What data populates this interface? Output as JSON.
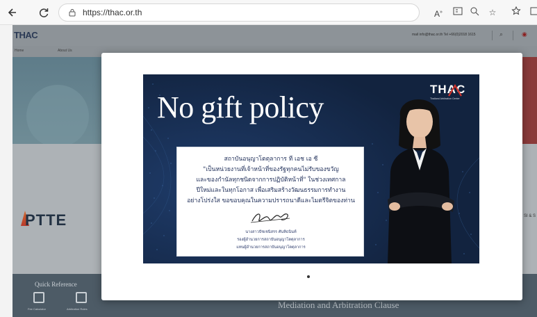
{
  "browser": {
    "back_icon": "arrow-left-icon",
    "refresh_icon": "refresh-icon",
    "url": "https://thac.or.th",
    "tools": [
      "read-aloud-icon",
      "immersive-reader-icon",
      "zoom-icon",
      "favorite-add-icon",
      "favorites-icon",
      "collections-icon"
    ]
  },
  "site": {
    "logo": "THAC",
    "contact": "mail info@thac.or.th   Tel +66(0)2018 1615",
    "nav": [
      "Home",
      "About Us"
    ],
    "partner_logo": "PTTE",
    "right_fragment": "SI & S",
    "quick_reference": {
      "title": "Quick Reference",
      "items": [
        "Fee Calculator",
        "Arbitration Rules"
      ]
    },
    "mediation_title": "Mediation and Arbitration Clause"
  },
  "modal": {
    "poster": {
      "title": "No gift policy",
      "brand": "THAC",
      "brand_sub": "Thailand Arbitration Center",
      "message": [
        "สถาบันอนุญาโตตุลาการ ที เอช เอ ซี",
        "\"เป็นหน่วยงานที่เจ้าหน้าที่ของรัฐทุกคนไม่รับของขวัญ",
        "และของกำนัลทุกชนิดจากการปฏิบัติหน้าที่\" ในช่วงเทศกาล",
        "ปีใหม่และในทุกโอกาส เพื่อเสริมสร้างวัฒนธรรมการทำงาน",
        "อย่างโปร่งใส ขอขอบคุณในความปรารถนาดีและไมตรีจิตของท่าน"
      ],
      "signer": [
        "นางสาวปัชเชนิสรร ศันทิธนินท์",
        "รองผู้อำนวยการสถาบันอนุญาโตตุลาการ",
        "แทนผู้อำนวยการสถาบันอนุญาโตตุลาการ"
      ]
    }
  },
  "colors": {
    "poster_bg": "#12233f",
    "modal_bg": "#ffffff",
    "overlay": "#aeb3b8",
    "accent_red": "#d0342c"
  }
}
